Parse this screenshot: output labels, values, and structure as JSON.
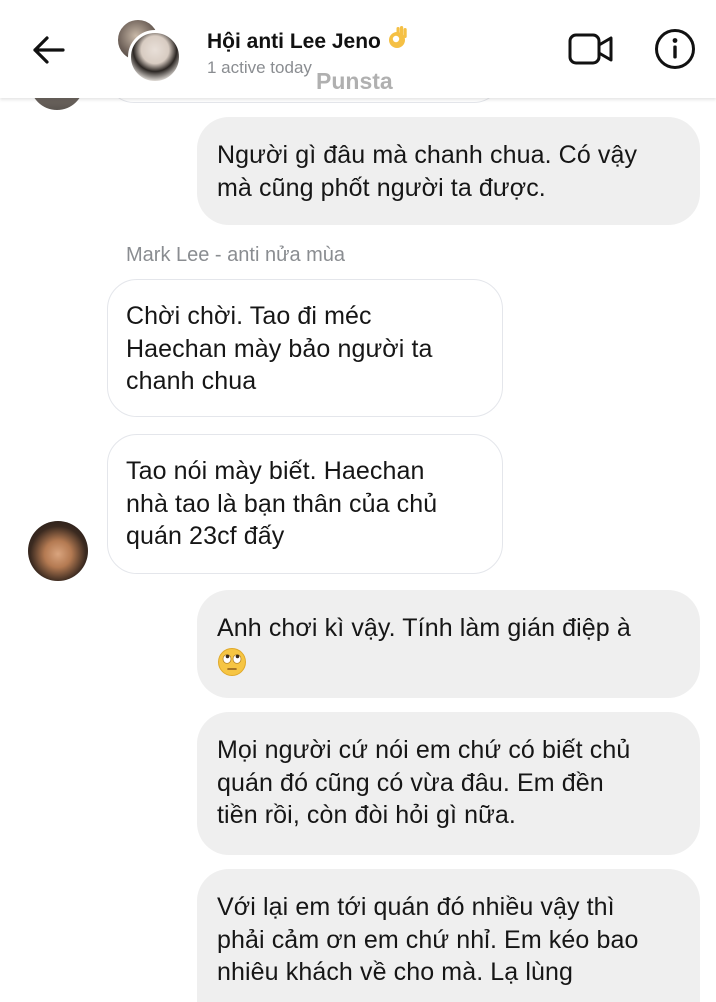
{
  "header": {
    "back_icon": "arrow-left-icon",
    "title": "Hội anti Lee Jeno",
    "title_emoji": "ok-hand-emoji",
    "subtitle": "1 active today",
    "watermark": "Punsta",
    "video_icon": "video-call-icon",
    "info_icon": "info-icon"
  },
  "messages": [
    {
      "direction": "out",
      "lines": [
        "Người gì đâu mà chanh chua. Có vậy",
        "mà cũng phốt người ta được."
      ]
    },
    {
      "direction": "in",
      "sender": "Mark Lee - anti nửa mùa",
      "lines": [
        "Chời chời. Tao đi méc",
        "Haechan mày bảo người ta",
        "chanh chua"
      ]
    },
    {
      "direction": "in",
      "lines": [
        "Tao nói mày biết. Haechan",
        "nhà tao là bạn thân của chủ",
        "quán 23cf đấy"
      ]
    },
    {
      "direction": "out",
      "lines": [
        "Anh chơi kì vậy. Tính làm gián điệp à"
      ],
      "emoji": "face-with-rolling-eyes-emoji"
    },
    {
      "direction": "out",
      "lines": [
        "Mọi người cứ nói em chứ có biết chủ",
        "quán đó cũng có vừa đâu. Em đền",
        "tiền rồi, còn đòi hỏi gì nữa."
      ]
    },
    {
      "direction": "out",
      "lines": [
        "Với lại em tới quán đó nhiều vậy thì",
        "phải cảm ơn em chứ nhỉ. Em kéo bao",
        "nhiêu khách về cho mà. Lạ lùng"
      ]
    }
  ],
  "colors": {
    "outgoing_bubble": "#efefef",
    "incoming_border": "#e4e6eb",
    "meta_text": "#8a8d91",
    "text": "#161616"
  }
}
